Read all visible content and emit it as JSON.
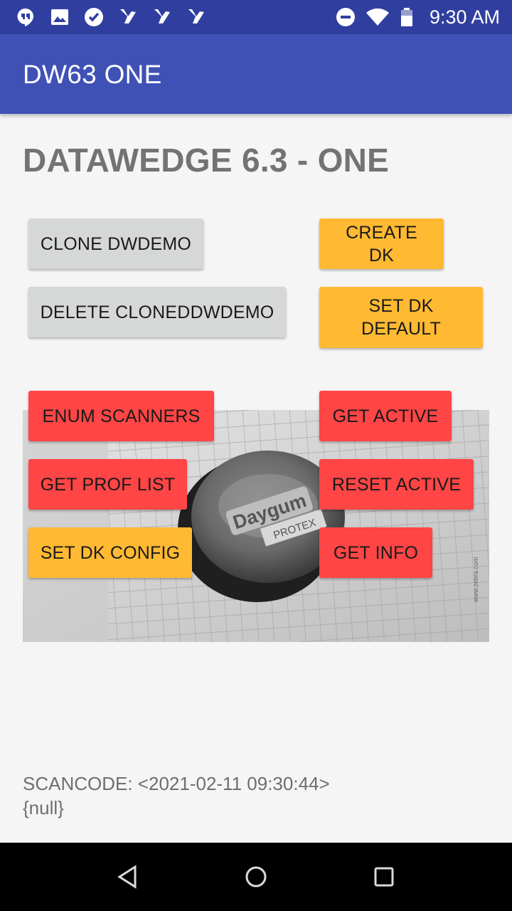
{
  "status_bar": {
    "time": "9:30 AM",
    "left_icons": [
      "hangouts-icon",
      "image-icon",
      "check-circle-icon",
      "app-notification-icon",
      "app-notification-icon",
      "app-notification-icon"
    ],
    "right_icons": [
      "do-not-disturb-icon",
      "wifi-icon",
      "battery-icon"
    ]
  },
  "app_bar": {
    "title": "DW63 ONE"
  },
  "main": {
    "heading": "DATAWEDGE 6.3 - ONE",
    "buttons": {
      "clone_dwdemo": "CLONE DWDEMO",
      "create_dk": "CREATE DK",
      "delete_cloned": "DELETE CLONEDDWDEMO",
      "set_dk_default": "SET DK DEFAULT",
      "enum_scanners": "ENUM SCANNERS",
      "get_active": "GET ACTIVE",
      "get_prof_list": "GET PROF LIST",
      "reset_active": "RESET ACTIVE",
      "set_dk_config": "SET DK CONFIG",
      "get_info": "GET INFO"
    },
    "camera_preview": {
      "label_brand": "Daygum",
      "label_sub": "PROTEX",
      "side_text": "www.zebra.com"
    },
    "scan_result": {
      "line1": "SCANCODE: <2021-02-11 09:30:44>",
      "line2": "{null}"
    }
  },
  "colors": {
    "status_bar": "#303f9f",
    "app_bar": "#3f51b5",
    "grey_button": "#d6d7d7",
    "amber_button": "#ffb933",
    "red_button": "#ff4545"
  },
  "nav_bar": {
    "icons": [
      "back-icon",
      "home-icon",
      "recents-icon"
    ]
  }
}
